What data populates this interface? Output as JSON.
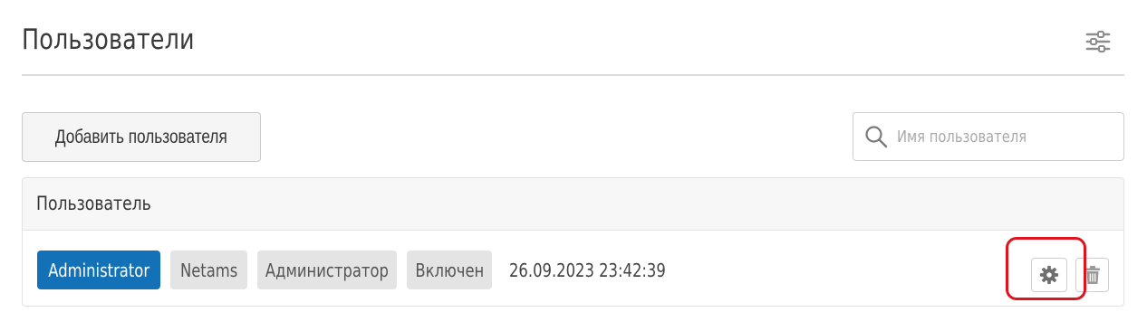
{
  "page": {
    "title": "Пользователи"
  },
  "toolbar": {
    "add_user_label": "Добавить пользователя",
    "search_placeholder": "Имя пользователя",
    "search_value": ""
  },
  "table": {
    "columns": [
      "Пользователь"
    ],
    "rows": [
      {
        "username": "Administrator",
        "group": "Netams",
        "role": "Администратор",
        "status": "Включен",
        "last_login": "26.09.2023 23:42:39"
      }
    ]
  },
  "icons": {
    "filter": "sliders-icon",
    "search": "search-icon",
    "settings": "gear-icon",
    "delete": "trash-icon"
  },
  "colors": {
    "primary_badge": "#1371b8",
    "secondary_badge": "#e4e4e4",
    "highlight": "#e0131f"
  }
}
